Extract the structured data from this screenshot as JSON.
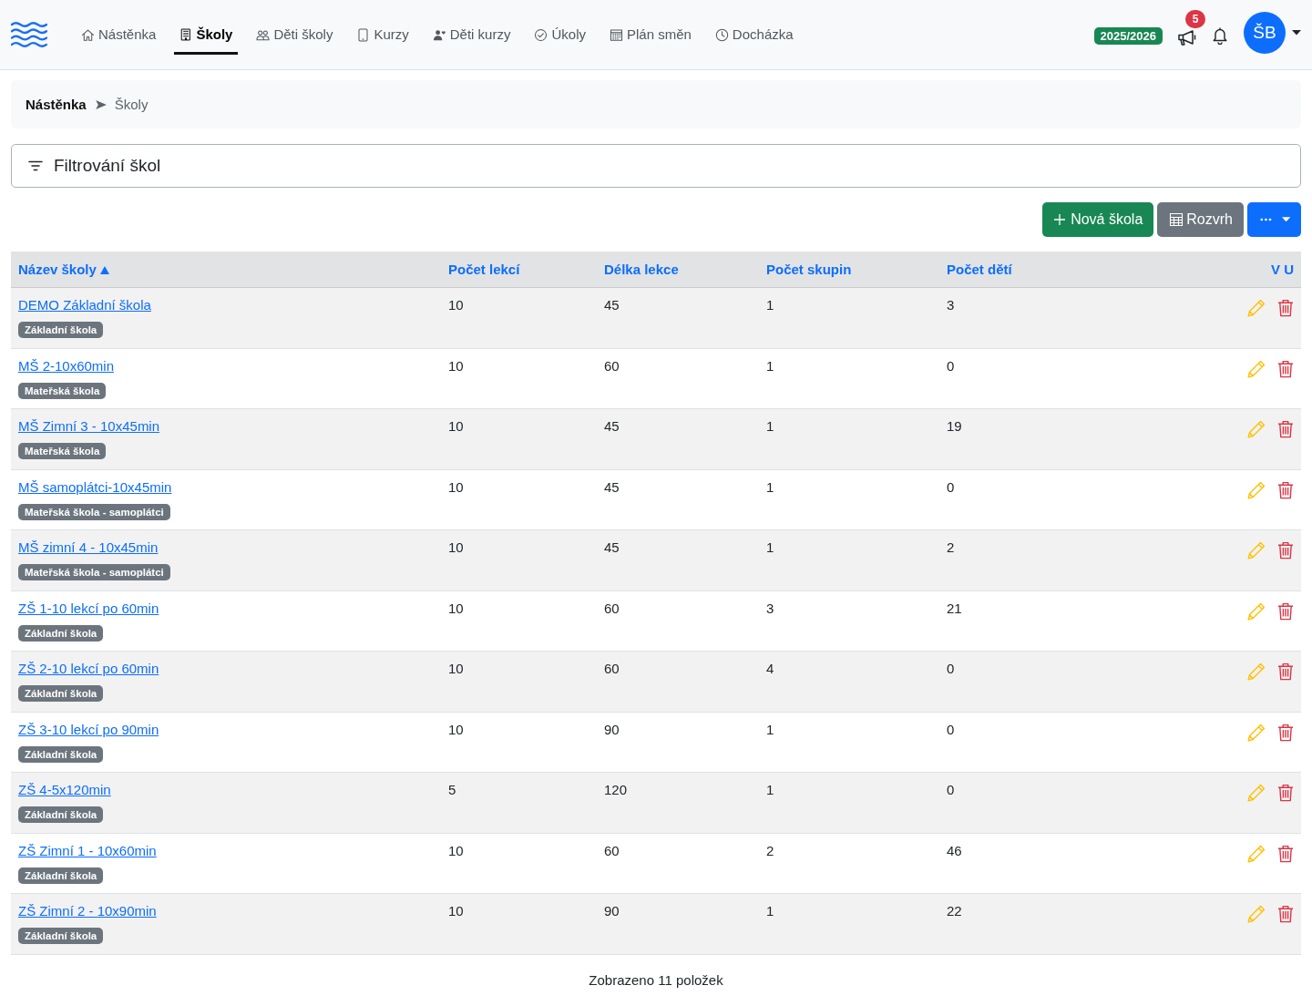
{
  "navbar": {
    "nav_items": [
      {
        "label": "Nástěnka",
        "selected": false
      },
      {
        "label": "Školy",
        "selected": true
      },
      {
        "label": "Děti školy",
        "selected": false
      },
      {
        "label": "Kurzy",
        "selected": false
      },
      {
        "label": "Děti kurzy",
        "selected": false
      },
      {
        "label": "Úkoly",
        "selected": false
      },
      {
        "label": "Plán směn",
        "selected": false
      },
      {
        "label": "Docházka",
        "selected": false
      }
    ],
    "school_year": "2025/2026",
    "announcements_count": "5",
    "user_initials": "ŠB"
  },
  "breadcrumb": [
    {
      "label": "Nástěnka",
      "current": false
    },
    {
      "label": "Školy",
      "current": true
    }
  ],
  "filter": {
    "title": "Filtrování škol"
  },
  "toolbar": {
    "new_button": "Nová škola",
    "schedule_button": "Rozvrh"
  },
  "table": {
    "columns": [
      {
        "label": "Název školy",
        "sorted": true
      },
      {
        "label": "Počet lekcí",
        "sorted": false
      },
      {
        "label": "Délka lekce",
        "sorted": false
      },
      {
        "label": "Počet skupin",
        "sorted": false
      },
      {
        "label": "Počet dětí",
        "sorted": false
      },
      {
        "label": "V U",
        "sorted": false
      }
    ],
    "rows": [
      {
        "name": "DEMO Základní škola",
        "type": "Základní škola",
        "lessons": "10",
        "lesson_length": "45",
        "groups": "1",
        "children": "3"
      },
      {
        "name": "MŠ 2-10x60min",
        "type": "Mateřská škola",
        "lessons": "10",
        "lesson_length": "60",
        "groups": "1",
        "children": "0"
      },
      {
        "name": "MŠ Zimní 3 - 10x45min",
        "type": "Mateřská škola",
        "lessons": "10",
        "lesson_length": "45",
        "groups": "1",
        "children": "19"
      },
      {
        "name": "MŠ samoplátci-10x45min",
        "type": "Mateřská škola - samoplátci",
        "lessons": "10",
        "lesson_length": "45",
        "groups": "1",
        "children": "0"
      },
      {
        "name": "MŠ zimní 4 - 10x45min",
        "type": "Mateřská škola - samoplátci",
        "lessons": "10",
        "lesson_length": "45",
        "groups": "1",
        "children": "2"
      },
      {
        "name": "ZŠ 1-10 lekcí po 60min",
        "type": "Základní škola",
        "lessons": "10",
        "lesson_length": "60",
        "groups": "3",
        "children": "21"
      },
      {
        "name": "ZŠ 2-10 lekcí po 60min",
        "type": "Základní škola",
        "lessons": "10",
        "lesson_length": "60",
        "groups": "4",
        "children": "0"
      },
      {
        "name": "ZŠ 3-10 lekcí po 90min",
        "type": "Základní škola",
        "lessons": "10",
        "lesson_length": "90",
        "groups": "1",
        "children": "0"
      },
      {
        "name": "ZŠ 4-5x120min",
        "type": "Základní škola",
        "lessons": "5",
        "lesson_length": "120",
        "groups": "1",
        "children": "0"
      },
      {
        "name": "ZŠ Zimní 1 - 10x60min",
        "type": "Základní škola",
        "lessons": "10",
        "lesson_length": "60",
        "groups": "2",
        "children": "46"
      },
      {
        "name": "ZŠ Zimní 2 - 10x90min",
        "type": "Základní škola",
        "lessons": "10",
        "lesson_length": "90",
        "groups": "1",
        "children": "22"
      }
    ]
  },
  "footer": "Zobrazeno 11 položek"
}
